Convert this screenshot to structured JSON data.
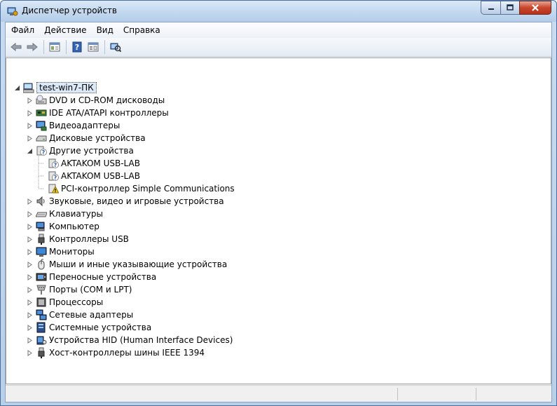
{
  "window": {
    "title": "Диспетчер устройств"
  },
  "menu": [
    {
      "label": "Файл"
    },
    {
      "label": "Действие"
    },
    {
      "label": "Вид"
    },
    {
      "label": "Справка"
    }
  ],
  "toolbar": {
    "icons": [
      "back-arrow-icon",
      "forward-arrow-icon",
      "properties-icon",
      "help-icon",
      "view-icon",
      "scan-hardware-icon"
    ]
  },
  "tree": {
    "root": {
      "label": "test-win7-ПК",
      "icon": "computer-icon"
    },
    "items": [
      {
        "label": "DVD и CD-ROM дисководы",
        "icon": "dvd-drive-icon",
        "expanded": false
      },
      {
        "label": "IDE ATA/ATAPI контроллеры",
        "icon": "ide-controller-icon",
        "expanded": false
      },
      {
        "label": "Видеоадаптеры",
        "icon": "display-adapter-icon",
        "expanded": false
      },
      {
        "label": "Дисковые устройства",
        "icon": "disk-drive-icon",
        "expanded": false
      },
      {
        "label": "Другие устройства",
        "icon": "unknown-device-icon",
        "expanded": true,
        "children": [
          {
            "label": "AKTAKOM USB-LAB",
            "icon": "unknown-device-icon"
          },
          {
            "label": "AKTAKOM USB-LAB",
            "icon": "unknown-device-icon"
          },
          {
            "label": "PCI-контроллер Simple Communications",
            "icon": "warning-device-icon"
          }
        ]
      },
      {
        "label": "Звуковые, видео и игровые устройства",
        "icon": "sound-icon",
        "expanded": false
      },
      {
        "label": "Клавиатуры",
        "icon": "keyboard-icon",
        "expanded": false
      },
      {
        "label": "Компьютер",
        "icon": "computer-icon",
        "expanded": false
      },
      {
        "label": "Контроллеры USB",
        "icon": "usb-icon",
        "expanded": false
      },
      {
        "label": "Мониторы",
        "icon": "monitor-icon",
        "expanded": false
      },
      {
        "label": "Мыши и иные указывающие устройства",
        "icon": "mouse-icon",
        "expanded": false
      },
      {
        "label": "Переносные устройства",
        "icon": "portable-device-icon",
        "expanded": false
      },
      {
        "label": "Порты (COM и LPT)",
        "icon": "port-icon",
        "expanded": false
      },
      {
        "label": "Процессоры",
        "icon": "processor-icon",
        "expanded": false
      },
      {
        "label": "Сетевые адаптеры",
        "icon": "network-adapter-icon",
        "expanded": false
      },
      {
        "label": "Системные устройства",
        "icon": "system-device-icon",
        "expanded": false
      },
      {
        "label": "Устройства HID (Human Interface Devices)",
        "icon": "hid-icon",
        "expanded": false
      },
      {
        "label": "Хост-контроллеры шины IEEE 1394",
        "icon": "ieee1394-icon",
        "expanded": false
      }
    ]
  }
}
